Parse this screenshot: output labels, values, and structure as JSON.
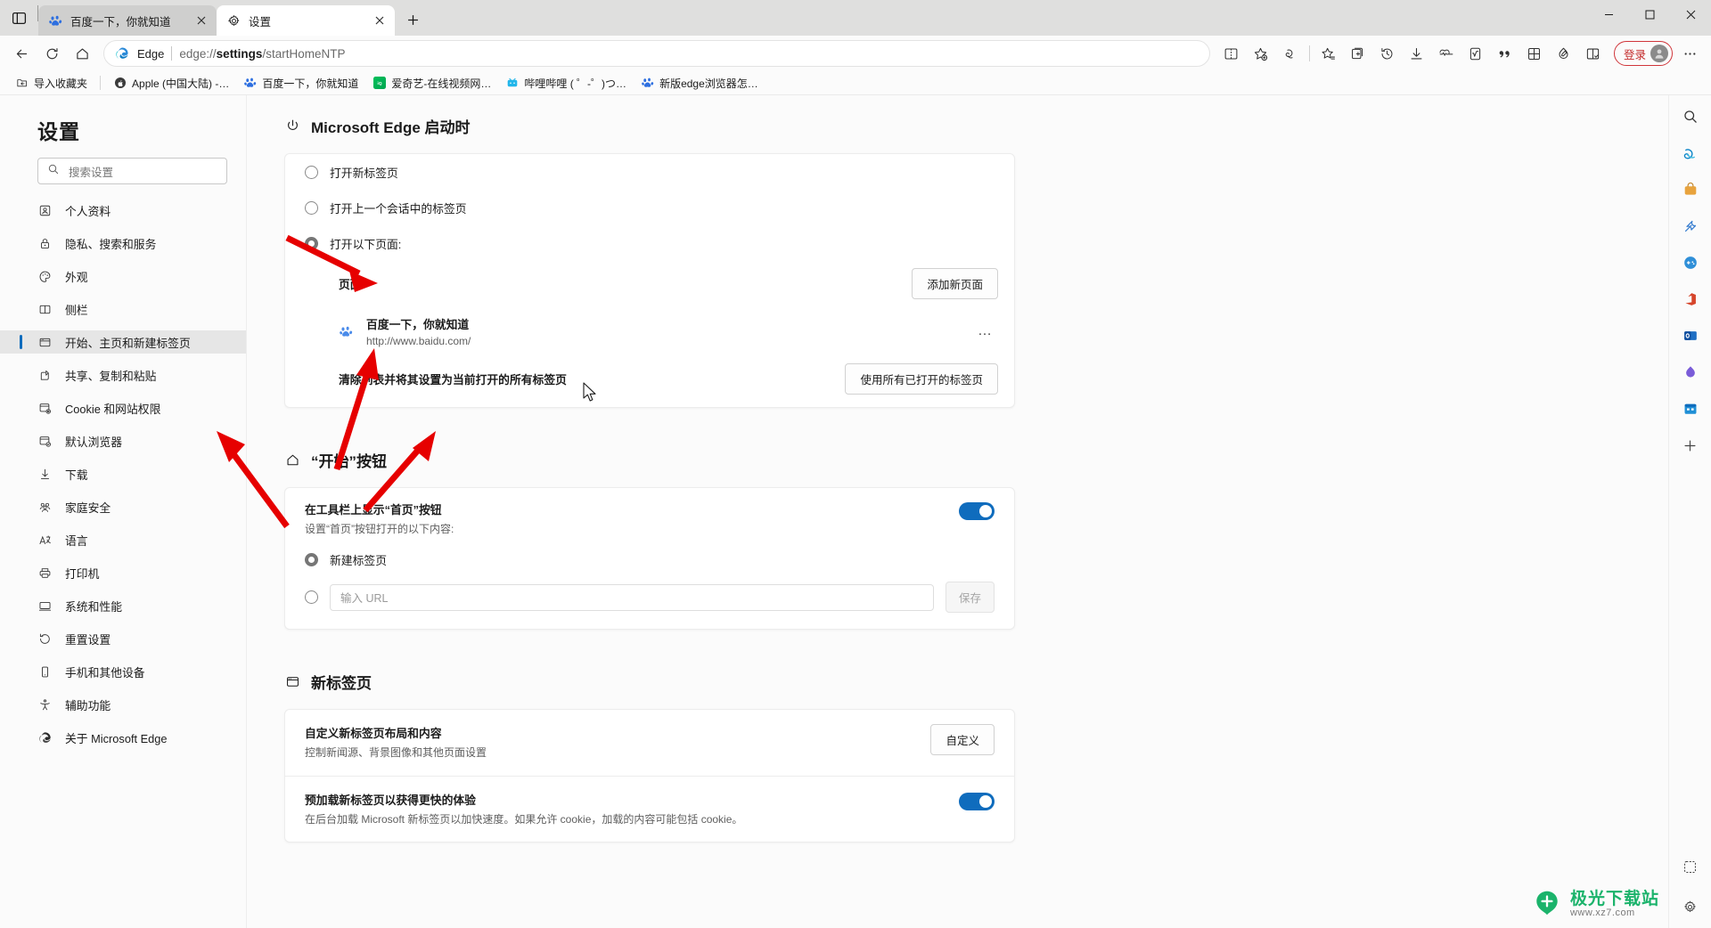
{
  "window": {
    "tab_overview_icon": "tab-overview-icon",
    "tabs": [
      {
        "title": "百度一下，你就知道",
        "favicon": "baidu-icon",
        "active": false
      },
      {
        "title": "设置",
        "favicon": "gear-icon",
        "active": true
      }
    ],
    "new_tab_label": "+",
    "controls": {
      "minimize": "minimize-icon",
      "maximize": "maximize-icon",
      "close": "close-icon"
    }
  },
  "toolbar": {
    "back": "back-arrow-icon",
    "refresh": "refresh-icon",
    "home": "home-icon",
    "omnibox": {
      "brand": "Edge",
      "url_prefix": "edge://",
      "url_bold": "settings",
      "url_suffix": "/startHomeNTP",
      "full_url": "edge://settings/startHomeNTP"
    },
    "right_icons": [
      "split-screen-icon",
      "add-favorite-icon",
      "copilot-icon",
      "favorites-icon",
      "collections-icon",
      "history-icon",
      "downloads-icon",
      "health-icon",
      "math-solver-icon",
      "quote-icon",
      "gift-icon",
      "drop-icon",
      "browser-essentials-icon"
    ],
    "signin_label": "登录",
    "more_label": "…"
  },
  "bookmarks": {
    "import_label": "导入收藏夹",
    "items": [
      {
        "label": "Apple (中国大陆) -…",
        "icon": "apple-icon"
      },
      {
        "label": "百度一下，你就知道",
        "icon": "baidu-icon"
      },
      {
        "label": "爱奇艺-在线视频网…",
        "icon": "iqiyi-icon"
      },
      {
        "label": "哔哩哔哩 ( ゜-゜)つ…",
        "icon": "bilibili-icon"
      },
      {
        "label": "新版edge浏览器怎…",
        "icon": "baidu-icon"
      }
    ]
  },
  "sidebar": {
    "title": "设置",
    "search_placeholder": "搜索设置",
    "search_icon": "search-icon",
    "items": [
      {
        "label": "个人资料",
        "icon": "profile-icon",
        "selected": false
      },
      {
        "label": "隐私、搜索和服务",
        "icon": "lock-icon",
        "selected": false
      },
      {
        "label": "外观",
        "icon": "palette-icon",
        "selected": false
      },
      {
        "label": "侧栏",
        "icon": "sidebar-icon",
        "selected": false
      },
      {
        "label": "开始、主页和新建标签页",
        "icon": "window-icon",
        "selected": true
      },
      {
        "label": "共享、复制和粘贴",
        "icon": "share-icon",
        "selected": false
      },
      {
        "label": "Cookie 和网站权限",
        "icon": "cookie-icon",
        "selected": false
      },
      {
        "label": "默认浏览器",
        "icon": "default-browser-icon",
        "selected": false
      },
      {
        "label": "下载",
        "icon": "download-icon",
        "selected": false
      },
      {
        "label": "家庭安全",
        "icon": "family-icon",
        "selected": false
      },
      {
        "label": "语言",
        "icon": "language-icon",
        "selected": false
      },
      {
        "label": "打印机",
        "icon": "printer-icon",
        "selected": false
      },
      {
        "label": "系统和性能",
        "icon": "system-icon",
        "selected": false
      },
      {
        "label": "重置设置",
        "icon": "reset-icon",
        "selected": false
      },
      {
        "label": "手机和其他设备",
        "icon": "phone-icon",
        "selected": false
      },
      {
        "label": "辅助功能",
        "icon": "accessibility-icon",
        "selected": false
      },
      {
        "label": "关于 Microsoft Edge",
        "icon": "edge-icon",
        "selected": false
      }
    ]
  },
  "main": {
    "startup": {
      "heading": "Microsoft Edge 启动时",
      "heading_icon": "power-icon",
      "options": [
        {
          "label": "打开新标签页",
          "checked": false
        },
        {
          "label": "打开上一个会话中的标签页",
          "checked": false
        },
        {
          "label": "打开以下页面:",
          "checked": true
        }
      ],
      "pages_header": "页面",
      "add_page_button": "添加新页面",
      "pages": [
        {
          "title": "百度一下，你就知道",
          "url": "http://www.baidu.com/",
          "favicon": "baidu-icon",
          "more": "…"
        }
      ],
      "clear_label": "清除列表并将其设置为当前打开的所有标签页",
      "use_open_tabs_button": "使用所有已打开的标签页"
    },
    "home_button": {
      "heading": "“开始”按钮",
      "heading_icon": "home-icon",
      "show_label": "在工具栏上显示“首页”按钮",
      "show_toggle_on": true,
      "sub_label": "设置“首页”按钮打开的以下内容:",
      "options": [
        {
          "label": "新建标签页",
          "checked": true
        }
      ],
      "url_placeholder": "输入 URL",
      "url_value": "",
      "save_button": "保存"
    },
    "new_tab": {
      "heading": "新标签页",
      "heading_icon": "newtab-icon",
      "rows": [
        {
          "title": "自定义新标签页布局和内容",
          "desc": "控制新闻源、背景图像和其他页面设置",
          "button": "自定义",
          "control": "button"
        },
        {
          "title": "预加载新标签页以获得更快的体验",
          "desc": "在后台加载 Microsoft 新标签页以加快速度。如果允许 cookie，加载的内容可能包括 cookie。",
          "toggle_on": true,
          "control": "toggle"
        }
      ]
    }
  },
  "edge_sidebar": {
    "icons": [
      "search-icon",
      "copilot-icon",
      "shopping-icon",
      "tools-icon",
      "games-icon",
      "office-icon",
      "outlook-icon",
      "dropshop-icon",
      "calendar-icon",
      "add-icon"
    ],
    "bottom_icons": [
      "customize-icon",
      "settings-icon"
    ]
  },
  "colors": {
    "accent": "#0f6cbd",
    "selected_nav_bg": "#e6e6e6",
    "arrow_red": "#e60000",
    "signin_red": "#c42b2b",
    "watermark_green": "#1bb36b"
  },
  "watermark": {
    "main": "极光下载站",
    "sub": "www.xz7.com"
  }
}
